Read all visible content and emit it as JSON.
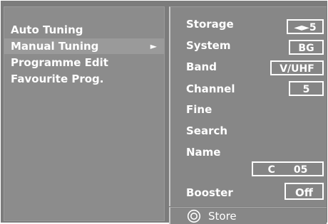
{
  "menu": {
    "items": [
      {
        "label": "Auto Tuning"
      },
      {
        "label": "Manual Tuning",
        "selected": true,
        "arrow": "►"
      },
      {
        "label": "Programme Edit"
      },
      {
        "label": "Favourite Prog."
      }
    ]
  },
  "settings": {
    "storage": {
      "label": "Storage",
      "value": "◄►5"
    },
    "system": {
      "label": "System",
      "value": "BG"
    },
    "band": {
      "label": "Band",
      "value": "V/UHF"
    },
    "channel": {
      "label": "Channel",
      "value": "5"
    },
    "fine": {
      "label": "Fine"
    },
    "search": {
      "label": "Search"
    },
    "name": {
      "label": "Name",
      "prefix": "C",
      "number": "05"
    },
    "booster": {
      "label": "Booster",
      "value": "Off"
    }
  },
  "footer": {
    "icon": "ok-circle-icon",
    "label": "Store"
  },
  "colors": {
    "frame": "#7c7c7c",
    "panel": "#878787",
    "selected": "#9a9a9a",
    "text": "#ffffff"
  }
}
